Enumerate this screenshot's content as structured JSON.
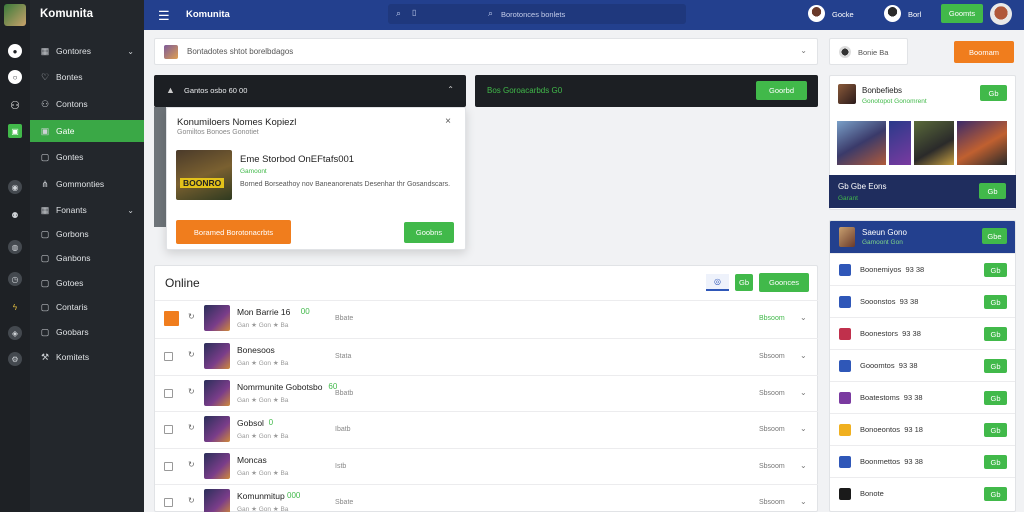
{
  "colors": {
    "topbar": "#23408e",
    "sidebar": "#23272c",
    "rail": "#1e2125",
    "accent_green": "#41b94a",
    "accent_orange": "#f07d1d"
  },
  "sidebar": {
    "brand": "Komunita",
    "items": [
      {
        "label": "Gontores",
        "icon": "grid-icon",
        "chevron": true
      },
      {
        "label": "Bontes",
        "icon": "heart-icon"
      },
      {
        "label": "Contons",
        "icon": "people-icon"
      },
      {
        "label": "Gate",
        "icon": "gamepad-icon",
        "active": true
      },
      {
        "label": "Gontes",
        "icon": "square-icon"
      },
      {
        "label": "Gommonties",
        "icon": "tree-icon"
      },
      {
        "label": "Fonants",
        "icon": "grid-icon",
        "chevron": true
      },
      {
        "label": "Gorbons",
        "icon": "square-icon"
      },
      {
        "label": "Ganbons",
        "icon": "square-icon"
      },
      {
        "label": "Gotoes",
        "icon": "square-icon"
      },
      {
        "label": "Contaris",
        "icon": "square-icon"
      },
      {
        "label": "Goobars",
        "icon": "square-icon"
      },
      {
        "label": "Komitets",
        "icon": "tool-icon"
      }
    ]
  },
  "topbar": {
    "title": "Komunita",
    "search_placeholder": "Borotonces bonlets",
    "user1": "Gocke",
    "user2": "Borl",
    "cta": "Goomts"
  },
  "filter": {
    "text": "Bontadotes shtot borelbdagos"
  },
  "dark_panel": {
    "header": "Gantos osbo 60 00"
  },
  "dark_panel2": {
    "header": "Bos Goroacarbds G0",
    "button": "Goorbd"
  },
  "popup": {
    "title": "Konumiloers Nomes Kopiezl",
    "subtitle": "Gomiltos Bonoes Gonotiet",
    "game_title": "Eme Storbod OnEFtafs001",
    "game_tag": "Gamoont",
    "game_desc": "Borned Borseathoy nov Baneanorenats Desenhar thr Gosandscars.",
    "cover_text": "BOONRO",
    "primary": "Boramed Borotonacrbts",
    "secondary": "Goobns"
  },
  "online": {
    "title": "Online",
    "btn_small": "Gb",
    "btn_main": "Goonces",
    "rows": [
      {
        "name": "Mon Barrie 16",
        "badge": "00",
        "stars": "Gan ★ Gon ★ Ba",
        "meta": "Bbate",
        "status": "Bbsoom",
        "status_green": true,
        "highlight": true
      },
      {
        "name": "Bonesoos",
        "badge": "",
        "stars": "Gan ★ Gon ★ Ba",
        "meta": "Stata",
        "status": "Sbsoom",
        "status_green": false
      },
      {
        "name": "Nomrmunite Gobotsbo",
        "badge": "60",
        "stars": "Gan ★ Gon ★ Ba",
        "meta": "Bbatb",
        "status": "Sbsoom",
        "status_green": false
      },
      {
        "name": "Gobsol",
        "badge": "0",
        "stars": "Gan ★ Gon ★ Ba",
        "meta": "Ibatb",
        "status": "Sbsoom",
        "status_green": false
      },
      {
        "name": "Moncas",
        "badge": "",
        "stars": "Gan ★ Gon ★ Ba",
        "meta": "Istb",
        "status": "Sbsoom",
        "status_green": false
      },
      {
        "name": "Komunmitup",
        "badge": "000",
        "stars": "Gan ★ Gon ★ Ba",
        "meta": "Sbate",
        "status": "Sbsoom",
        "status_green": false
      }
    ]
  },
  "right": {
    "search": "Bonie Ba",
    "orange_btn": "Boomam",
    "featured": {
      "name": "Bonbefiebs",
      "sub": "Gonotopot Gonomrent",
      "btn": "Gb"
    },
    "dark_bar": {
      "text": "Gb Gbe Eons",
      "tag": "Garant",
      "btn": "Gb"
    },
    "blue_header": {
      "title": "Saeun Gono",
      "sub": "Gamoont Gon",
      "btn": "Gbe"
    },
    "rows": [
      {
        "label": "Boonemiyos  93 38",
        "btn": "Gb",
        "color": "#2f57b8"
      },
      {
        "label": "Sooonstos  93 38",
        "btn": "Gb",
        "color": "#2f57b8"
      },
      {
        "label": "Boonestors  93 38",
        "btn": "Gb",
        "color": "#c0304c"
      },
      {
        "label": "Gooomtos  93 38",
        "btn": "Gb",
        "color": "#2f57b8"
      },
      {
        "label": "Boatestoms  93 38",
        "btn": "Gb",
        "color": "#7a3aa0"
      },
      {
        "label": "Bonoeontos  93 18",
        "btn": "Gb",
        "color": "#f0b020"
      },
      {
        "label": "Boonmettos  93 38",
        "btn": "Gb",
        "color": "#2f57b8"
      },
      {
        "label": "Bonote",
        "btn": "Gb",
        "color": "#1a1a1a"
      }
    ]
  }
}
